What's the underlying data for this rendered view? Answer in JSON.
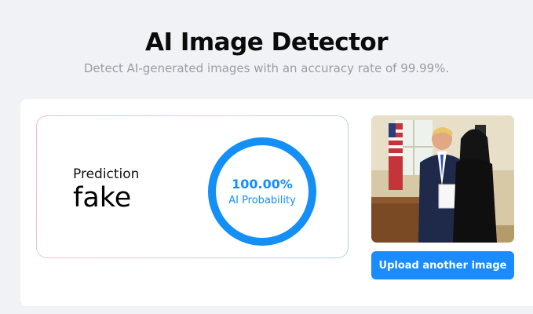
{
  "header": {
    "title": "AI Image Detector",
    "subtitle": "Detect AI-generated images with an accuracy rate of 99.99%."
  },
  "result": {
    "prediction_label": "Prediction",
    "prediction_value": "fake",
    "probability_value": "100.00%",
    "probability_label": "AI Probability",
    "probability_fraction": 1.0
  },
  "upload": {
    "button_label": "Upload another image"
  },
  "colors": {
    "accent": "#148ff6",
    "button": "#1a8cff"
  }
}
